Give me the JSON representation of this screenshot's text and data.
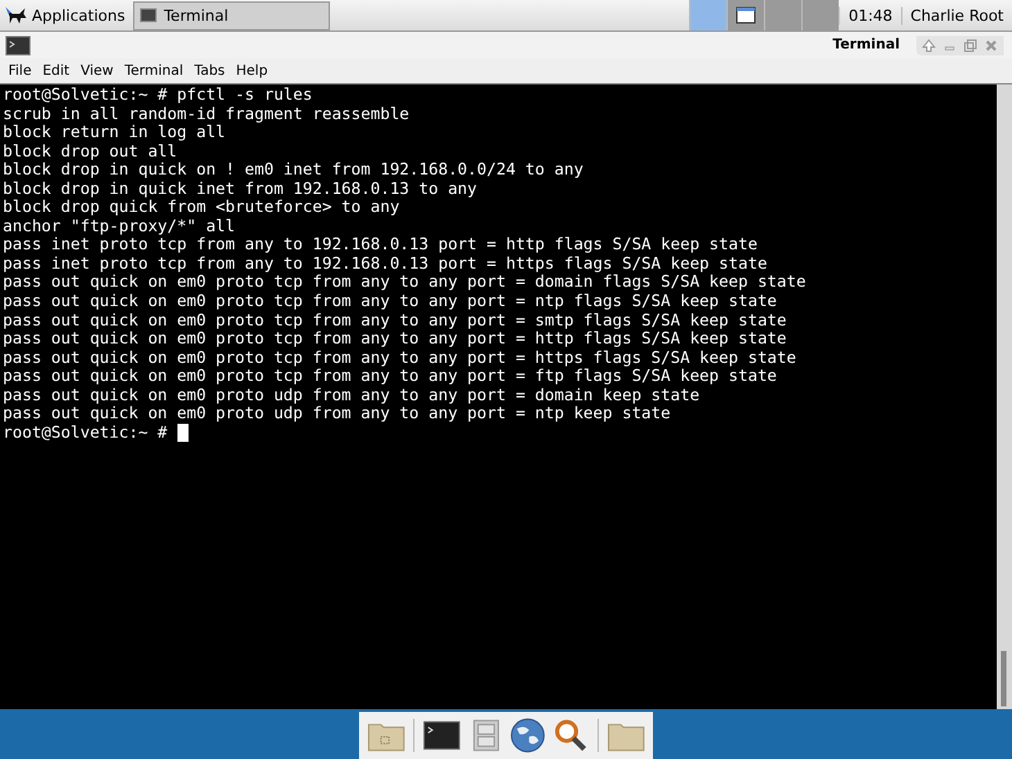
{
  "top_panel": {
    "applications": "Applications",
    "tasks": [
      {
        "label": "Terminal"
      }
    ],
    "workspaces": [
      {
        "selected": true
      },
      {
        "selected": false
      },
      {
        "selected": false
      },
      {
        "selected": false
      }
    ],
    "clock": "01:48",
    "user": "Charlie Root"
  },
  "window": {
    "title": "Terminal"
  },
  "menu": [
    "File",
    "Edit",
    "View",
    "Terminal",
    "Tabs",
    "Help"
  ],
  "terminal": {
    "lines": [
      "root@Solvetic:~ # pfctl -s rules",
      "scrub in all random-id fragment reassemble",
      "block return in log all",
      "block drop out all",
      "block drop in quick on ! em0 inet from 192.168.0.0/24 to any",
      "block drop in quick inet from 192.168.0.13 to any",
      "block drop quick from <bruteforce> to any",
      "anchor \"ftp-proxy/*\" all",
      "pass inet proto tcp from any to 192.168.0.13 port = http flags S/SA keep state",
      "pass inet proto tcp from any to 192.168.0.13 port = https flags S/SA keep state",
      "pass out quick on em0 proto tcp from any to any port = domain flags S/SA keep state",
      "pass out quick on em0 proto tcp from any to any port = ntp flags S/SA keep state",
      "pass out quick on em0 proto tcp from any to any port = smtp flags S/SA keep state",
      "pass out quick on em0 proto tcp from any to any port = http flags S/SA keep state",
      "pass out quick on em0 proto tcp from any to any port = https flags S/SA keep state",
      "pass out quick on em0 proto tcp from any to any port = ftp flags S/SA keep state",
      "pass out quick on em0 proto udp from any to any port = domain keep state",
      "pass out quick on em0 proto udp from any to any port = ntp keep state"
    ],
    "prompt": "root@Solvetic:~ #"
  }
}
